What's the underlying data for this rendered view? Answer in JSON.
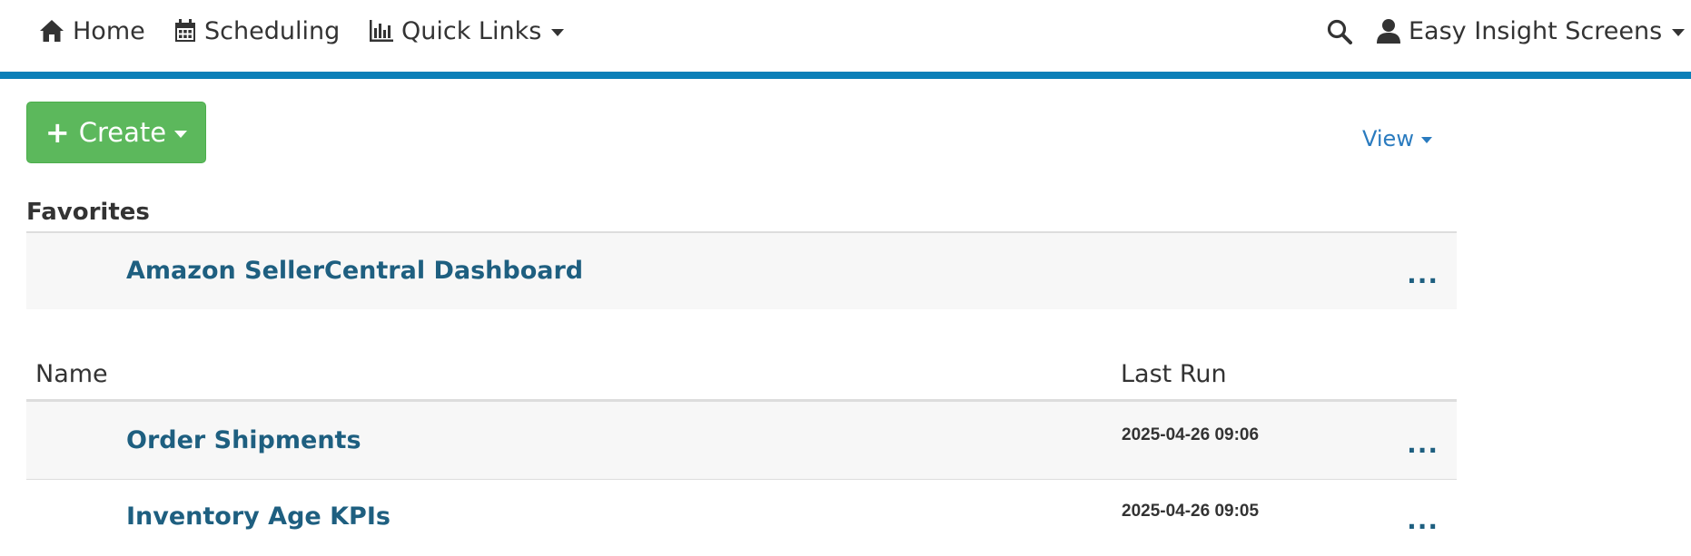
{
  "nav": {
    "home": "Home",
    "scheduling": "Scheduling",
    "quick_links": "Quick Links",
    "user": "Easy Insight Screens"
  },
  "toolbar": {
    "create_label": "Create",
    "view_label": "View"
  },
  "favorites": {
    "title": "Favorites",
    "items": [
      {
        "name": "Amazon SellerCentral Dashboard",
        "more": "..."
      }
    ]
  },
  "table": {
    "columns": [
      "Name",
      "Last Run"
    ],
    "rows": [
      {
        "name": "Order Shipments",
        "last_run": "2025-04-26 09:06",
        "more": "..."
      },
      {
        "name": "Inventory Age KPIs",
        "last_run": "2025-04-26 09:05",
        "more": "..."
      }
    ]
  },
  "colors": {
    "accent_bar": "#0a7fb8",
    "create_button": "#5cb85c",
    "link": "#1e5f80",
    "view_link": "#2a7bbf"
  },
  "icons": [
    "home-icon",
    "calendar-icon",
    "bar-chart-icon",
    "search-icon",
    "user-icon"
  ]
}
